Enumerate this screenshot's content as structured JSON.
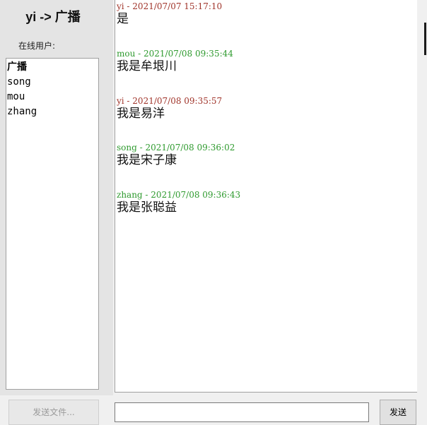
{
  "title": "yi -> 广播",
  "online_label": "在线用户:",
  "users": [
    "广播",
    "song",
    "mou",
    "zhang"
  ],
  "selected_user": "广播",
  "messages": [
    {
      "header": "yi - 2021/07/07 15:17:10",
      "body": "是",
      "color": "#a0342a"
    },
    {
      "header": "mou - 2021/07/08 09:35:44",
      "body": "我是牟垠川",
      "color": "#2e9a2e"
    },
    {
      "header": "yi - 2021/07/08 09:35:57",
      "body": "我是易洋",
      "color": "#a0342a"
    },
    {
      "header": "song - 2021/07/08 09:36:02",
      "body": "我是宋子康",
      "color": "#2e9a2e"
    },
    {
      "header": "zhang - 2021/07/08 09:36:43",
      "body": "我是张聪益",
      "color": "#2e9a2e"
    }
  ],
  "input": {
    "value": "",
    "placeholder": ""
  },
  "buttons": {
    "send_file": "发送文件...",
    "send": "发送"
  }
}
